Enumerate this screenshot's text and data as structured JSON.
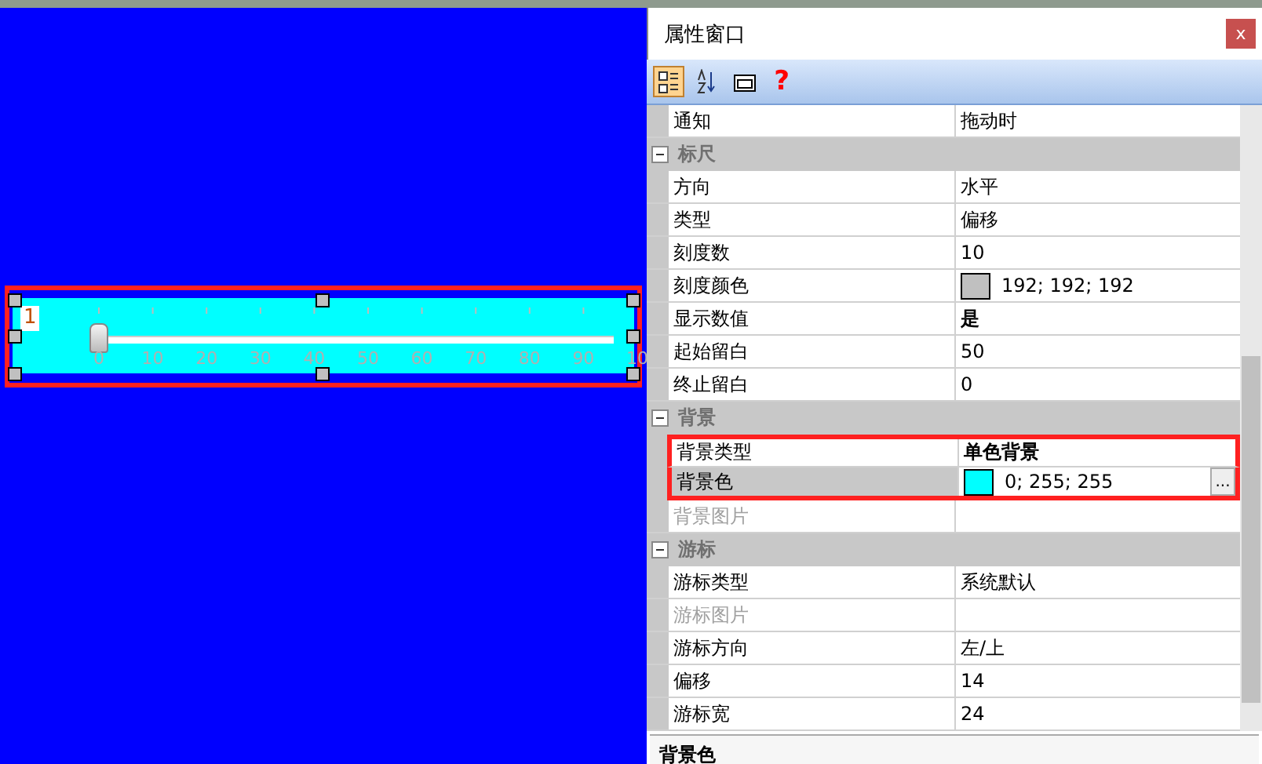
{
  "canvas": {
    "widget": {
      "label": "1",
      "selected": true,
      "highlighted": true,
      "slider": {
        "level": 0
      },
      "tick_labels": [
        "0",
        "10",
        "20",
        "30",
        "40",
        "50",
        "60",
        "70",
        "80",
        "90",
        "10"
      ]
    }
  },
  "panel": {
    "title": "属性窗口",
    "close": "x",
    "toolbar": [
      {
        "kind": "categorized",
        "selected": true
      },
      {
        "kind": "alphabetical",
        "selected": false
      },
      {
        "kind": "pages",
        "selected": false
      },
      {
        "kind": "help",
        "label": "?",
        "selected": false
      }
    ],
    "rows": [
      {
        "kind": "text",
        "name": "通知",
        "value": "拖动时",
        "selected": false,
        "disabled": false,
        "bold": false,
        "highlighted": false
      },
      {
        "kind": "group",
        "name": "标尺",
        "expanded": true
      },
      {
        "kind": "text",
        "name": "方向",
        "value": "水平",
        "selected": false,
        "disabled": false,
        "bold": false,
        "highlighted": false
      },
      {
        "kind": "text",
        "name": "类型",
        "value": "偏移",
        "selected": false,
        "disabled": false,
        "bold": false,
        "highlighted": false
      },
      {
        "kind": "text",
        "name": "刻度数",
        "value": "10",
        "selected": false,
        "disabled": false,
        "bold": false,
        "highlighted": false
      },
      {
        "kind": "color",
        "name": "刻度颜色",
        "value": "192; 192; 192",
        "color": "#c0c0c0",
        "selected": false,
        "disabled": false,
        "bold": false,
        "highlighted": false
      },
      {
        "kind": "text",
        "name": "显示数值",
        "value": "是",
        "selected": false,
        "disabled": false,
        "bold": true,
        "highlighted": false
      },
      {
        "kind": "text",
        "name": "起始留白",
        "value": "50",
        "selected": false,
        "disabled": false,
        "bold": false,
        "highlighted": false
      },
      {
        "kind": "text",
        "name": "终止留白",
        "value": "0",
        "selected": false,
        "disabled": false,
        "bold": false,
        "highlighted": false
      },
      {
        "kind": "group",
        "name": "背景",
        "expanded": true
      },
      {
        "kind": "text",
        "name": "背景类型",
        "value": "单色背景",
        "selected": false,
        "disabled": false,
        "bold": true,
        "highlighted": true
      },
      {
        "kind": "color",
        "name": "背景色",
        "value": "0; 255; 255",
        "color": "#00ffff",
        "button": "...",
        "selected": true,
        "disabled": false,
        "bold": false,
        "highlighted": true
      },
      {
        "kind": "text",
        "name": "背景图片",
        "value": "",
        "selected": false,
        "disabled": true,
        "bold": false,
        "highlighted": false
      },
      {
        "kind": "group",
        "name": "游标",
        "expanded": true
      },
      {
        "kind": "text",
        "name": "游标类型",
        "value": "系统默认",
        "selected": false,
        "disabled": false,
        "bold": false,
        "highlighted": false
      },
      {
        "kind": "text",
        "name": "游标图片",
        "value": "",
        "selected": false,
        "disabled": true,
        "bold": false,
        "highlighted": false
      },
      {
        "kind": "text",
        "name": "游标方向",
        "value": "左/上",
        "selected": false,
        "disabled": false,
        "bold": false,
        "highlighted": false
      },
      {
        "kind": "text",
        "name": "偏移",
        "value": "14",
        "selected": false,
        "disabled": false,
        "bold": false,
        "highlighted": false
      },
      {
        "kind": "text",
        "name": "游标宽",
        "value": "24",
        "selected": false,
        "disabled": false,
        "bold": false,
        "highlighted": false
      }
    ],
    "status": "背景色"
  }
}
